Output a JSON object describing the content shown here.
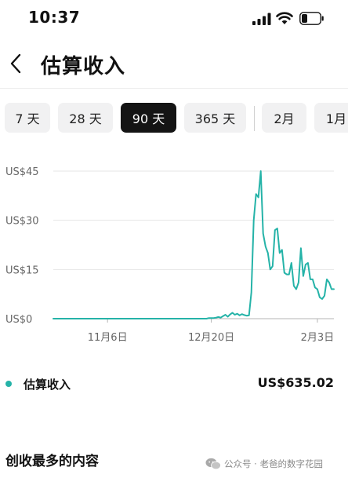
{
  "status_bar": {
    "time": "10:37"
  },
  "header": {
    "title": "估算收入"
  },
  "range_tabs": {
    "items": [
      {
        "label": "7 天"
      },
      {
        "label": "28 天"
      },
      {
        "label": "90 天",
        "selected": true
      },
      {
        "label": "365 天"
      },
      {
        "label": "2月"
      },
      {
        "label": "1月"
      }
    ]
  },
  "colors": {
    "accent": "#25b3a8",
    "selected_tab_bg": "#141414",
    "tab_bg": "#f1f1f2"
  },
  "chart_data": {
    "type": "line",
    "title": "",
    "xlabel": "",
    "ylabel": "",
    "ylim": [
      0,
      45
    ],
    "y_ticks": [
      {
        "value": 45,
        "label": "US$45"
      },
      {
        "value": 30,
        "label": "US$30"
      },
      {
        "value": 15,
        "label": "US$15"
      },
      {
        "value": 0,
        "label": "US$0"
      }
    ],
    "x_ticks": [
      {
        "day": 23,
        "label": "11月6日"
      },
      {
        "day": 67,
        "label": "12月20日"
      },
      {
        "day": 112,
        "label": "2月3日"
      }
    ],
    "x_range": [
      0,
      119
    ],
    "grid": true,
    "series": [
      {
        "name": "估算收入",
        "points": [
          [
            0,
            0
          ],
          [
            5,
            0
          ],
          [
            10,
            0
          ],
          [
            15,
            0
          ],
          [
            20,
            0
          ],
          [
            25,
            0
          ],
          [
            30,
            0
          ],
          [
            35,
            0
          ],
          [
            40,
            0
          ],
          [
            45,
            0
          ],
          [
            50,
            0
          ],
          [
            55,
            0
          ],
          [
            60,
            0
          ],
          [
            65,
            0
          ],
          [
            66,
            0.2
          ],
          [
            67,
            0.2
          ],
          [
            68,
            0.2
          ],
          [
            69,
            0.3
          ],
          [
            70,
            0.5
          ],
          [
            71,
            0.3
          ],
          [
            72,
            0.8
          ],
          [
            73,
            1.2
          ],
          [
            74,
            0.6
          ],
          [
            75,
            1.3
          ],
          [
            76,
            1.8
          ],
          [
            77,
            1.2
          ],
          [
            78,
            1.5
          ],
          [
            79,
            1.0
          ],
          [
            80,
            1.4
          ],
          [
            81,
            1.1
          ],
          [
            82,
            0.9
          ],
          [
            83,
            1.0
          ],
          [
            84,
            8
          ],
          [
            85,
            30
          ],
          [
            86,
            38
          ],
          [
            87,
            37
          ],
          [
            88,
            45
          ],
          [
            89,
            26
          ],
          [
            90,
            22
          ],
          [
            91,
            20
          ],
          [
            92,
            15
          ],
          [
            93,
            16
          ],
          [
            94,
            27
          ],
          [
            95,
            27.5
          ],
          [
            96,
            20
          ],
          [
            97,
            21
          ],
          [
            98,
            14
          ],
          [
            99,
            13.5
          ],
          [
            100,
            13.5
          ],
          [
            101,
            17
          ],
          [
            102,
            10
          ],
          [
            103,
            9
          ],
          [
            104,
            11
          ],
          [
            105,
            21.5
          ],
          [
            106,
            13
          ],
          [
            107,
            16.5
          ],
          [
            108,
            17
          ],
          [
            109,
            12
          ],
          [
            110,
            12
          ],
          [
            111,
            9.5
          ],
          [
            112,
            9
          ],
          [
            113,
            6.5
          ],
          [
            114,
            6
          ],
          [
            115,
            7
          ],
          [
            116,
            12
          ],
          [
            117,
            11
          ],
          [
            118,
            9
          ],
          [
            119,
            9
          ]
        ]
      }
    ]
  },
  "legend": {
    "label": "估算收入",
    "value": "US$635.02"
  },
  "section": {
    "title": "创收最多的内容"
  },
  "watermark": {
    "text": "公众号 · 老爸的数字花园"
  }
}
